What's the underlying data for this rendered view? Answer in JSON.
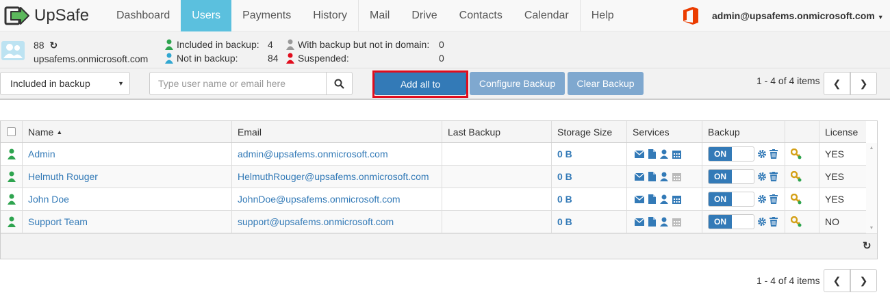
{
  "app": {
    "name": "UpSafe"
  },
  "nav": [
    {
      "label": "Dashboard"
    },
    {
      "label": "Users",
      "active": true
    },
    {
      "label": "Payments"
    },
    {
      "label": "History"
    },
    {
      "label": "Mail"
    },
    {
      "label": "Drive"
    },
    {
      "label": "Contacts"
    },
    {
      "label": "Calendar"
    },
    {
      "label": "Help"
    }
  ],
  "account": {
    "email": "admin@upsafems.onmicrosoft.com"
  },
  "info": {
    "user_count": "88",
    "domain": "upsafems.onmicrosoft.com",
    "included_label": "Included in backup:",
    "included_value": "4",
    "not_label": "Not in backup:",
    "not_value": "84",
    "notdomain_label": "With backup but not in domain:",
    "notdomain_value": "0",
    "suspended_label": "Suspended:",
    "suspended_value": "0"
  },
  "toolbar": {
    "filter_value": "Included in backup",
    "search_placeholder": "Type user name or email here",
    "add_all": "Add all to Backup",
    "configure": "Configure Backup",
    "clear": "Clear Backup",
    "pager": "1 - 4 of 4 items"
  },
  "table": {
    "headers": {
      "name": "Name",
      "email": "Email",
      "last_backup": "Last Backup",
      "storage": "Storage Size",
      "services": "Services",
      "backup": "Backup",
      "license": "License"
    },
    "sort_indicator": "▲",
    "toggle_on": "ON",
    "rows": [
      {
        "name": "Admin",
        "email": "admin@upsafems.onmicrosoft.com",
        "last_backup": "",
        "storage": "0 B",
        "license": "YES",
        "calendar_enabled": true
      },
      {
        "name": "Helmuth Rouger",
        "email": "HelmuthRouger@upsafems.onmicrosoft.com",
        "last_backup": "",
        "storage": "0 B",
        "license": "YES",
        "calendar_enabled": false
      },
      {
        "name": "John Doe",
        "email": "JohnDoe@upsafems.onmicrosoft.com",
        "last_backup": "",
        "storage": "0 B",
        "license": "YES",
        "calendar_enabled": true
      },
      {
        "name": "Support Team",
        "email": "support@upsafems.onmicrosoft.com",
        "last_backup": "",
        "storage": "0 B",
        "license": "NO",
        "calendar_enabled": false
      }
    ]
  },
  "bottom_pager": "1 - 4 of 4 items",
  "colors": {
    "accent": "#5bc0de",
    "primary": "#337ab7",
    "highlight": "#e10d1d",
    "green": "#2ea44f"
  }
}
